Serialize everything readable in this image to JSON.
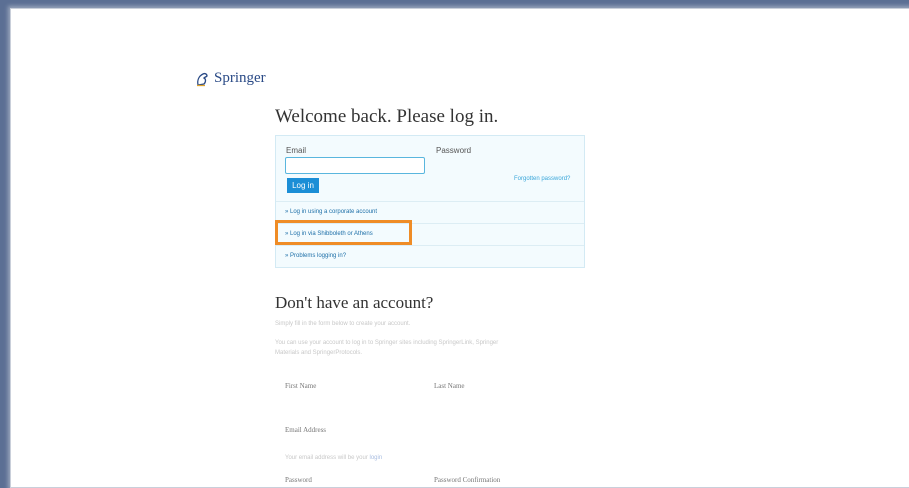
{
  "logo": {
    "name": "Springer",
    "icon": "springer-horse-icon"
  },
  "login": {
    "title": "Welcome back. Please log in.",
    "email_label": "Email",
    "email_value": "",
    "password_label": "Password",
    "login_button": "Log in",
    "forgot_link": "Forgotten password?",
    "links": [
      "» Log in using a corporate account",
      "» Log in via Shibboleth or Athens",
      "» Problems logging in?"
    ]
  },
  "register": {
    "title": "Don't have an account?",
    "intro": "Simply fill in the form below to create your account.",
    "intro2": "You can use your account to log in to Springer sites including SpringerLink, Springer",
    "intro3": "Materials and SpringerProtocols.",
    "first_name_label": "First Name",
    "last_name_label": "Last Name",
    "email_label": "Email Address",
    "email_hint": "Your email address will be your",
    "email_hint_link": "login",
    "password_label": "Password",
    "password_confirm_label": "Password Confirmation"
  },
  "colors": {
    "accent": "#1b8ed6",
    "highlight": "#ef8c26",
    "box_bg": "#f3fbfe"
  }
}
